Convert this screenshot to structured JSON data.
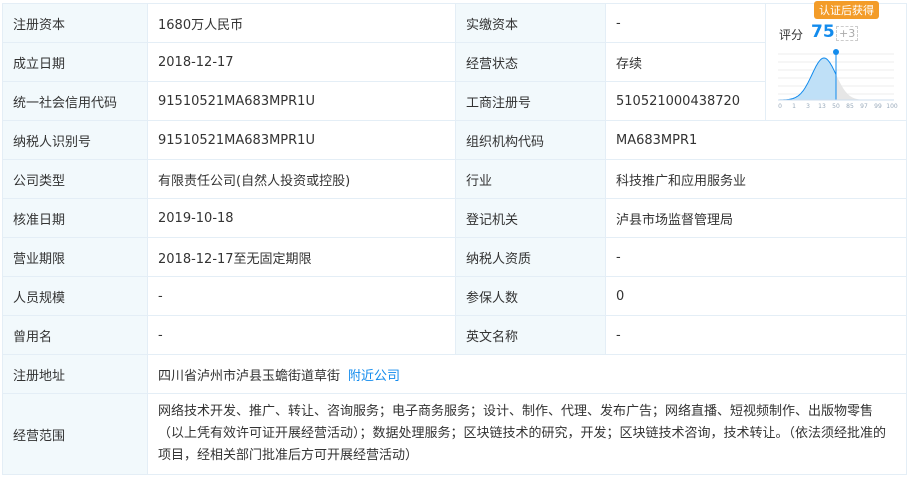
{
  "rows": [
    {
      "l1": "注册资本",
      "v1": "1680万人民币",
      "l2": "实缴资本",
      "v2": "-"
    },
    {
      "l1": "成立日期",
      "v1": "2018-12-17",
      "l2": "经营状态",
      "v2": "存续"
    },
    {
      "l1": "统一社会信用代码",
      "v1": "91510521MA683MPR1U",
      "l2": "工商注册号",
      "v2": "510521000438720"
    },
    {
      "l1": "纳税人识别号",
      "v1": "91510521MA683MPR1U",
      "l2": "组织机构代码",
      "v2": "MA683MPR1"
    },
    {
      "l1": "公司类型",
      "v1": "有限责任公司(自然人投资或控股)",
      "l2": "行业",
      "v2": "科技推广和应用服务业"
    },
    {
      "l1": "核准日期",
      "v1": "2019-10-18",
      "l2": "登记机关",
      "v2": "泸县市场监督管理局"
    },
    {
      "l1": "营业期限",
      "v1": "2018-12-17至无固定期限",
      "l2": "纳税人资质",
      "v2": "-"
    },
    {
      "l1": "人员规模",
      "v1": "-",
      "l2": "参保人数",
      "v2": "0"
    },
    {
      "l1": "曾用名",
      "v1": "-",
      "l2": "英文名称",
      "v2": "-"
    }
  ],
  "address": {
    "label": "注册地址",
    "value": "四川省泸州市泸县玉蟾街道草街",
    "link": "附近公司"
  },
  "scope": {
    "label": "经营范围",
    "value": "网络技术开发、推广、转让、咨询服务；电子商务服务；设计、制作、代理、发布广告；网络直播、短视频制作、出版物零售（以上凭有效许可证开展经营活动）；数据处理服务；区块链技术的研究，开发；区块链技术咨询，技术转让。（依法须经批准的项目，经相关部门批准后方可开展经营活动）"
  },
  "score": {
    "badge": "认证后获得",
    "label": "评分",
    "value": "75",
    "plus": "+3",
    "ticks": [
      "0",
      "1",
      "3",
      "13",
      "50",
      "85",
      "97",
      "99",
      "100"
    ],
    "accent": "#128bed"
  }
}
